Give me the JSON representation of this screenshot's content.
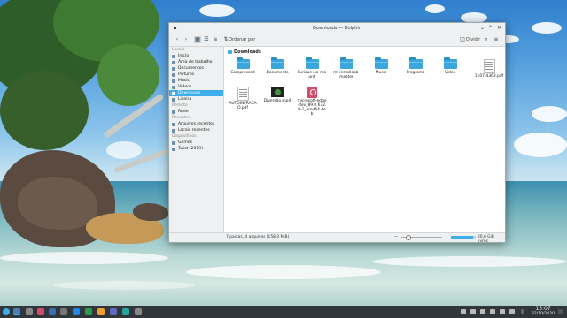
{
  "window": {
    "title": "Downloads — Dolphin"
  },
  "toolbar": {
    "sort_label": "Ordenar por",
    "split_label": "Dividir"
  },
  "sidebar": {
    "sections": [
      {
        "heading": "Locais",
        "items": [
          {
            "label": "Início",
            "icon": "home-icon"
          },
          {
            "label": "Área de trabalho",
            "icon": "desktop-icon"
          },
          {
            "label": "Documentos",
            "icon": "documents-icon"
          },
          {
            "label": "Pictures",
            "icon": "pictures-icon"
          },
          {
            "label": "Music",
            "icon": "music-icon"
          },
          {
            "label": "Vídeos",
            "icon": "videos-icon"
          },
          {
            "label": "Downloads",
            "icon": "downloads-icon",
            "selected": true
          },
          {
            "label": "Lixeira",
            "icon": "trash-icon"
          }
        ]
      },
      {
        "heading": "Remoto",
        "items": [
          {
            "label": "Rede",
            "icon": "network-icon"
          }
        ]
      },
      {
        "heading": "Recentes",
        "items": [
          {
            "label": "Arquivos recentes",
            "icon": "recent-files-icon"
          },
          {
            "label": "Locais recentes",
            "icon": "recent-places-icon"
          }
        ]
      },
      {
        "heading": "Dispositivos",
        "items": [
          {
            "label": "Games",
            "icon": "drive-icon"
          },
          {
            "label": "Twist (2019)",
            "icon": "drive-icon"
          }
        ]
      }
    ]
  },
  "location": {
    "breadcrumb": "Downloads"
  },
  "files": [
    {
      "name": "Compressed",
      "type": "folder"
    },
    {
      "name": "Documents",
      "type": "folder"
    },
    {
      "name": "Furious-iso-mount",
      "type": "folder"
    },
    {
      "name": "mf-installcab-master",
      "type": "folder"
    },
    {
      "name": "Music",
      "type": "folder"
    },
    {
      "name": "Programs",
      "type": "folder"
    },
    {
      "name": "Video",
      "type": "folder"
    },
    {
      "name": "1107-4363.pdf",
      "type": "pdf"
    },
    {
      "name": "AUTOINFRACAO.pdf",
      "type": "pdf"
    },
    {
      "name": "Diversão.mp4",
      "type": "video"
    },
    {
      "name": "microsoft-edge-dev_89.0.672.0-1_amd64.deb",
      "type": "deb"
    }
  ],
  "status": {
    "summary": "7 pastas, 4 arquivos (158,3 MiB)",
    "free_space": "20,6 GiB livres",
    "zoom_fraction": 0.15,
    "used_fraction": 0.9
  },
  "taskbar": {
    "time": "15:07",
    "date": "22/10/2020"
  },
  "colors": {
    "accent": "#3daee9",
    "taskbar": "#31363b",
    "window_chrome": "#eff0f1"
  }
}
